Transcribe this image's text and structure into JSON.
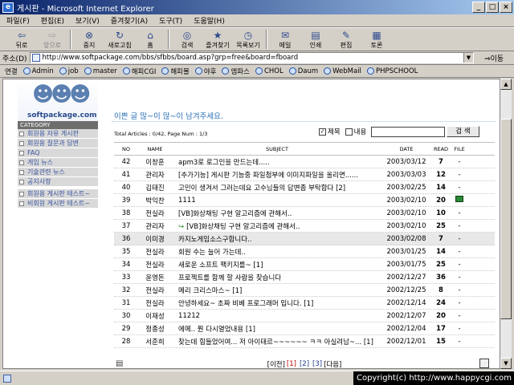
{
  "window": {
    "title": "게시판 - Microsoft Internet Explorer",
    "min": "_",
    "max": "□",
    "close": "×"
  },
  "menu": [
    "파일(F)",
    "편집(E)",
    "보기(V)",
    "즐겨찾기(A)",
    "도구(T)",
    "도움말(H)"
  ],
  "toolbar": [
    {
      "label": "뒤로",
      "icon": "back-icon",
      "glyph": "⇦",
      "enabled": true
    },
    {
      "label": "앞으로",
      "icon": "forward-icon",
      "glyph": "⇨",
      "enabled": false
    },
    {
      "label": "중지",
      "icon": "stop-icon",
      "glyph": "⊗",
      "enabled": true
    },
    {
      "label": "새로고침",
      "icon": "refresh-icon",
      "glyph": "↻",
      "enabled": true
    },
    {
      "label": "홈",
      "icon": "home-icon",
      "glyph": "⌂",
      "enabled": true
    },
    {
      "label": "검색",
      "icon": "search-icon",
      "glyph": "◎",
      "enabled": true
    },
    {
      "label": "즐겨찾기",
      "icon": "favorites-icon",
      "glyph": "★",
      "enabled": true
    },
    {
      "label": "목록보기",
      "icon": "history-icon",
      "glyph": "◷",
      "enabled": true
    },
    {
      "label": "메일",
      "icon": "mail-icon",
      "glyph": "✉",
      "enabled": true
    },
    {
      "label": "인쇄",
      "icon": "print-icon",
      "glyph": "▤",
      "enabled": true
    },
    {
      "label": "편집",
      "icon": "edit-icon",
      "glyph": "✎",
      "enabled": true
    },
    {
      "label": "토론",
      "icon": "discuss-icon",
      "glyph": "▦",
      "enabled": true
    }
  ],
  "address": {
    "label": "주소(D)",
    "url": "http://www.softpackage.com/bbs/sfbbs/board.asp?grp=free&board=fboard",
    "go": "⇒이동"
  },
  "links": {
    "label": "연결",
    "items": [
      "Admin",
      "job",
      "master",
      "해피CGI",
      "해피몰",
      "야후",
      "엠파스",
      "CHOL",
      "Daum",
      "WebMail",
      "PHPSCHOOL"
    ]
  },
  "sidebar": {
    "logo_text": "softpackage.com",
    "category_label": "CATEGORY",
    "items": [
      "회원용 자유 게시판",
      "회원용 질문과 답변",
      "FAQ",
      "게임 뉴스",
      "기술관련 뉴스",
      "공지사항",
      "회원용 게시판 테스트~",
      "비회원 게시판 테스트~"
    ]
  },
  "main": {
    "greeting": "이쁜 글 많~이 많~이 남겨주세요.",
    "info": "Total Articles : 0/42, Page Num : 1/3",
    "search": {
      "title_label": "제목",
      "content_label": "내용",
      "button": "검 색",
      "check": "✓"
    },
    "headers": {
      "no": "NO",
      "name": "NAME",
      "subject": "SUBJECT",
      "date": "DATE",
      "read": "READ",
      "file": "FILE"
    },
    "rows": [
      {
        "no": "42",
        "name": "이창훈",
        "subject": "apm3로 로그인을 만드는데.....",
        "date": "2003/03/12",
        "read": "7",
        "file": "-"
      },
      {
        "no": "41",
        "name": "관리자",
        "subject": "[추가기능] 게시판 기능중 파일첨부에 이미지파일을 올리면......",
        "date": "2003/03/03",
        "read": "12",
        "file": "-"
      },
      {
        "no": "40",
        "name": "김태진",
        "subject": "고민이 생겨서 그러는데요 고수님들의 답변좀 부탁합다 [2]",
        "date": "2003/02/25",
        "read": "14",
        "file": "-"
      },
      {
        "no": "39",
        "name": "박익찬",
        "subject": "1111",
        "date": "2003/02/10",
        "read": "20",
        "file": "icon"
      },
      {
        "no": "38",
        "name": "전실라",
        "subject": "[VB]화상채팅 구현 알고리즘에 관해서..",
        "date": "2003/02/10",
        "read": "10",
        "file": "-"
      },
      {
        "no": "37",
        "name": "관리자",
        "subject": "[VB]화상채팅 구현 알고리즘에 관해서..",
        "date": "2003/02/10",
        "read": "25",
        "file": "-",
        "reply": true
      },
      {
        "no": "36",
        "name": "이미경",
        "subject": "카지노게임소스구합니다..",
        "date": "2003/02/08",
        "read": "7",
        "file": "-"
      },
      {
        "no": "35",
        "name": "전실라",
        "subject": "회원 수는 늘어 가는데..",
        "date": "2003/01/25",
        "read": "14",
        "file": "-"
      },
      {
        "no": "34",
        "name": "전실라",
        "subject": "새로운 소프트 팩키지를~ [1]",
        "date": "2003/01/75",
        "read": "25",
        "file": "-"
      },
      {
        "no": "33",
        "name": "윤영돈",
        "subject": "프로젝트를 함께 할 사람을 찾습니다",
        "date": "2002/12/27",
        "read": "36",
        "file": "-"
      },
      {
        "no": "32",
        "name": "전실라",
        "subject": "메리 크리스마스~ [1]",
        "date": "2002/12/25",
        "read": "8",
        "file": "-"
      },
      {
        "no": "31",
        "name": "전실라",
        "subject": "안녕하세요~ 초짜 비베 프로그래머 입니다. [1]",
        "date": "2002/12/14",
        "read": "24",
        "file": "-"
      },
      {
        "no": "30",
        "name": "이재성",
        "subject": "11212",
        "date": "2002/12/07",
        "read": "20",
        "file": "-"
      },
      {
        "no": "29",
        "name": "정종성",
        "subject": "에메.. 뭔 다시열었내용 [1]",
        "date": "2002/12/04",
        "read": "17",
        "file": "-"
      },
      {
        "no": "28",
        "name": "서준희",
        "subject": "찾는데 힘들었어여... 저 아이태르~~~~~~ ㅋㅋ 아실려남~... [1]",
        "date": "2002/12/01",
        "read": "15",
        "file": "-"
      }
    ],
    "pager": {
      "prev": "[이전]",
      "pages": [
        "[1]",
        "[2]",
        "[3]"
      ],
      "next": "[다음]"
    }
  },
  "copyright": "Copyright(c) http://www.happycgi.com"
}
